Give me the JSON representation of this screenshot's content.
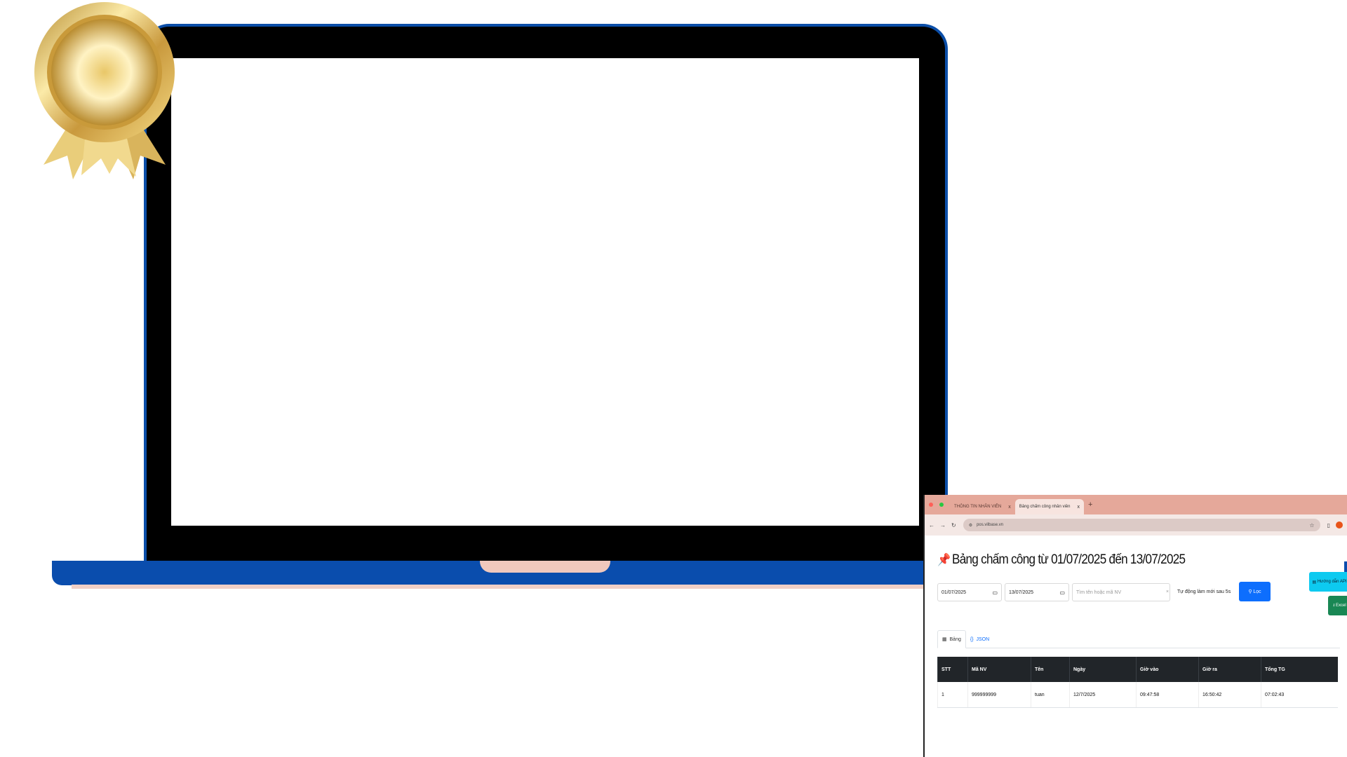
{
  "browser": {
    "tabs": [
      {
        "label": "THÔNG TIN NHÂN VIÊN",
        "active": false
      },
      {
        "label": "Bảng chấm công nhân viên",
        "active": true
      }
    ],
    "tab_close": "x",
    "new_tab": "+",
    "url": "pos.vilbase.vn"
  },
  "page": {
    "title": "Bảng chấm công từ 01/07/2025 đến 13/07/2025",
    "filters": {
      "from_date": "01/07/2025",
      "to_date": "13/07/2025",
      "search_placeholder": "Tìm tên hoặc mã NV",
      "auto_refresh_label": "Tự động làm mới sau 5s",
      "filter_button": "Lọc",
      "api_button": "Hướng dẫn API",
      "excel_button": "Excel"
    },
    "view_tabs": [
      {
        "label": "Bảng",
        "active": true
      },
      {
        "label": "JSON",
        "active": false
      }
    ],
    "table": {
      "headers": [
        "STT",
        "Mã NV",
        "Tên",
        "Ngày",
        "Giờ vào",
        "Giờ ra",
        "Tổng TG"
      ],
      "rows": [
        [
          "1",
          "999999999",
          "tuan",
          "12/7/2025",
          "09:47:58",
          "16:50:42",
          "07:02:43"
        ]
      ]
    }
  },
  "colors": {
    "laptop_frame": "#0b4ea8",
    "tabbar": "#e5a89a",
    "primary": "#0d6efd",
    "info": "#0dcaf0",
    "success": "#198754",
    "table_header": "#212529"
  },
  "icons": {
    "title": "pushpin-icon",
    "date": "calendar-icon",
    "api": "book-icon",
    "excel": "download-icon",
    "filter": "filter-icon"
  }
}
